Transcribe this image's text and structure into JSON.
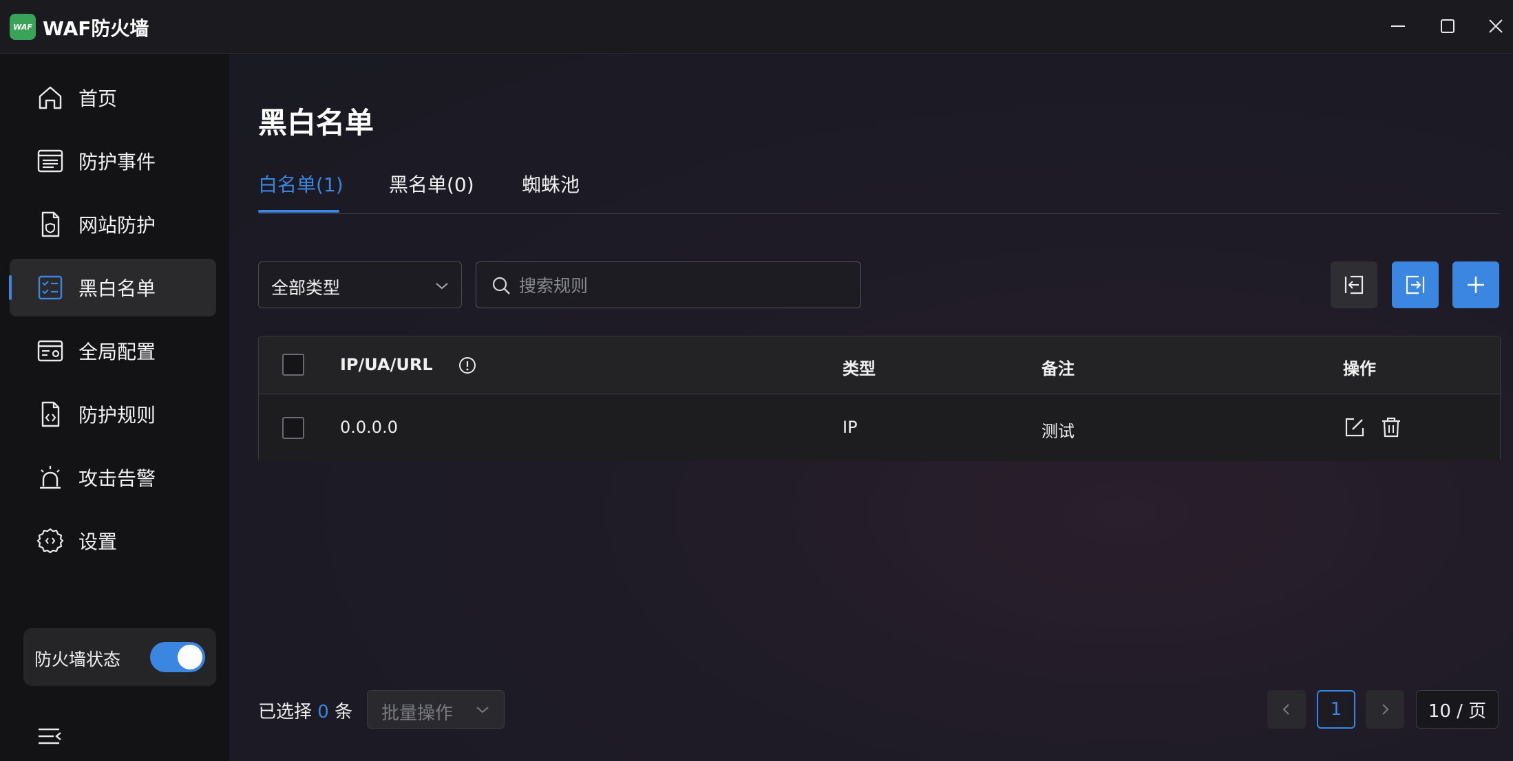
{
  "app": {
    "logo_text": "WAF",
    "title": "WAF防火墙"
  },
  "sidebar": {
    "items": [
      {
        "label": "首页",
        "icon": "home-icon"
      },
      {
        "label": "防护事件",
        "icon": "event-list-icon"
      },
      {
        "label": "网站防护",
        "icon": "site-shield-icon"
      },
      {
        "label": "黑白名单",
        "icon": "checklist-icon",
        "active": true
      },
      {
        "label": "全局配置",
        "icon": "browser-settings-icon"
      },
      {
        "label": "防护规则",
        "icon": "rule-file-icon"
      },
      {
        "label": "攻击告警",
        "icon": "alarm-icon"
      },
      {
        "label": "设置",
        "icon": "gear-icon"
      }
    ],
    "status": {
      "label": "防火墙状态",
      "enabled": true
    }
  },
  "main": {
    "title": "黑白名单",
    "tabs": [
      {
        "label": "白名单(1)",
        "active": true
      },
      {
        "label": "黑名单(0)"
      },
      {
        "label": "蜘蛛池"
      }
    ],
    "filter": {
      "selected": "全部类型"
    },
    "search": {
      "placeholder": "搜索规则",
      "value": ""
    },
    "table": {
      "columns": [
        "IP/UA/URL",
        "类型",
        "备注",
        "操作"
      ],
      "rows": [
        {
          "rule": "0.0.0.0",
          "type": "IP",
          "note": "测试"
        }
      ]
    },
    "footer": {
      "selected_prefix": "已选择",
      "selected_count": "0",
      "selected_suffix": "条",
      "batch_label": "批量操作",
      "current_page": "1",
      "page_size": "10 / 页"
    }
  },
  "colors": {
    "accent": "#3a86e0",
    "logo": "#3aa35a"
  }
}
